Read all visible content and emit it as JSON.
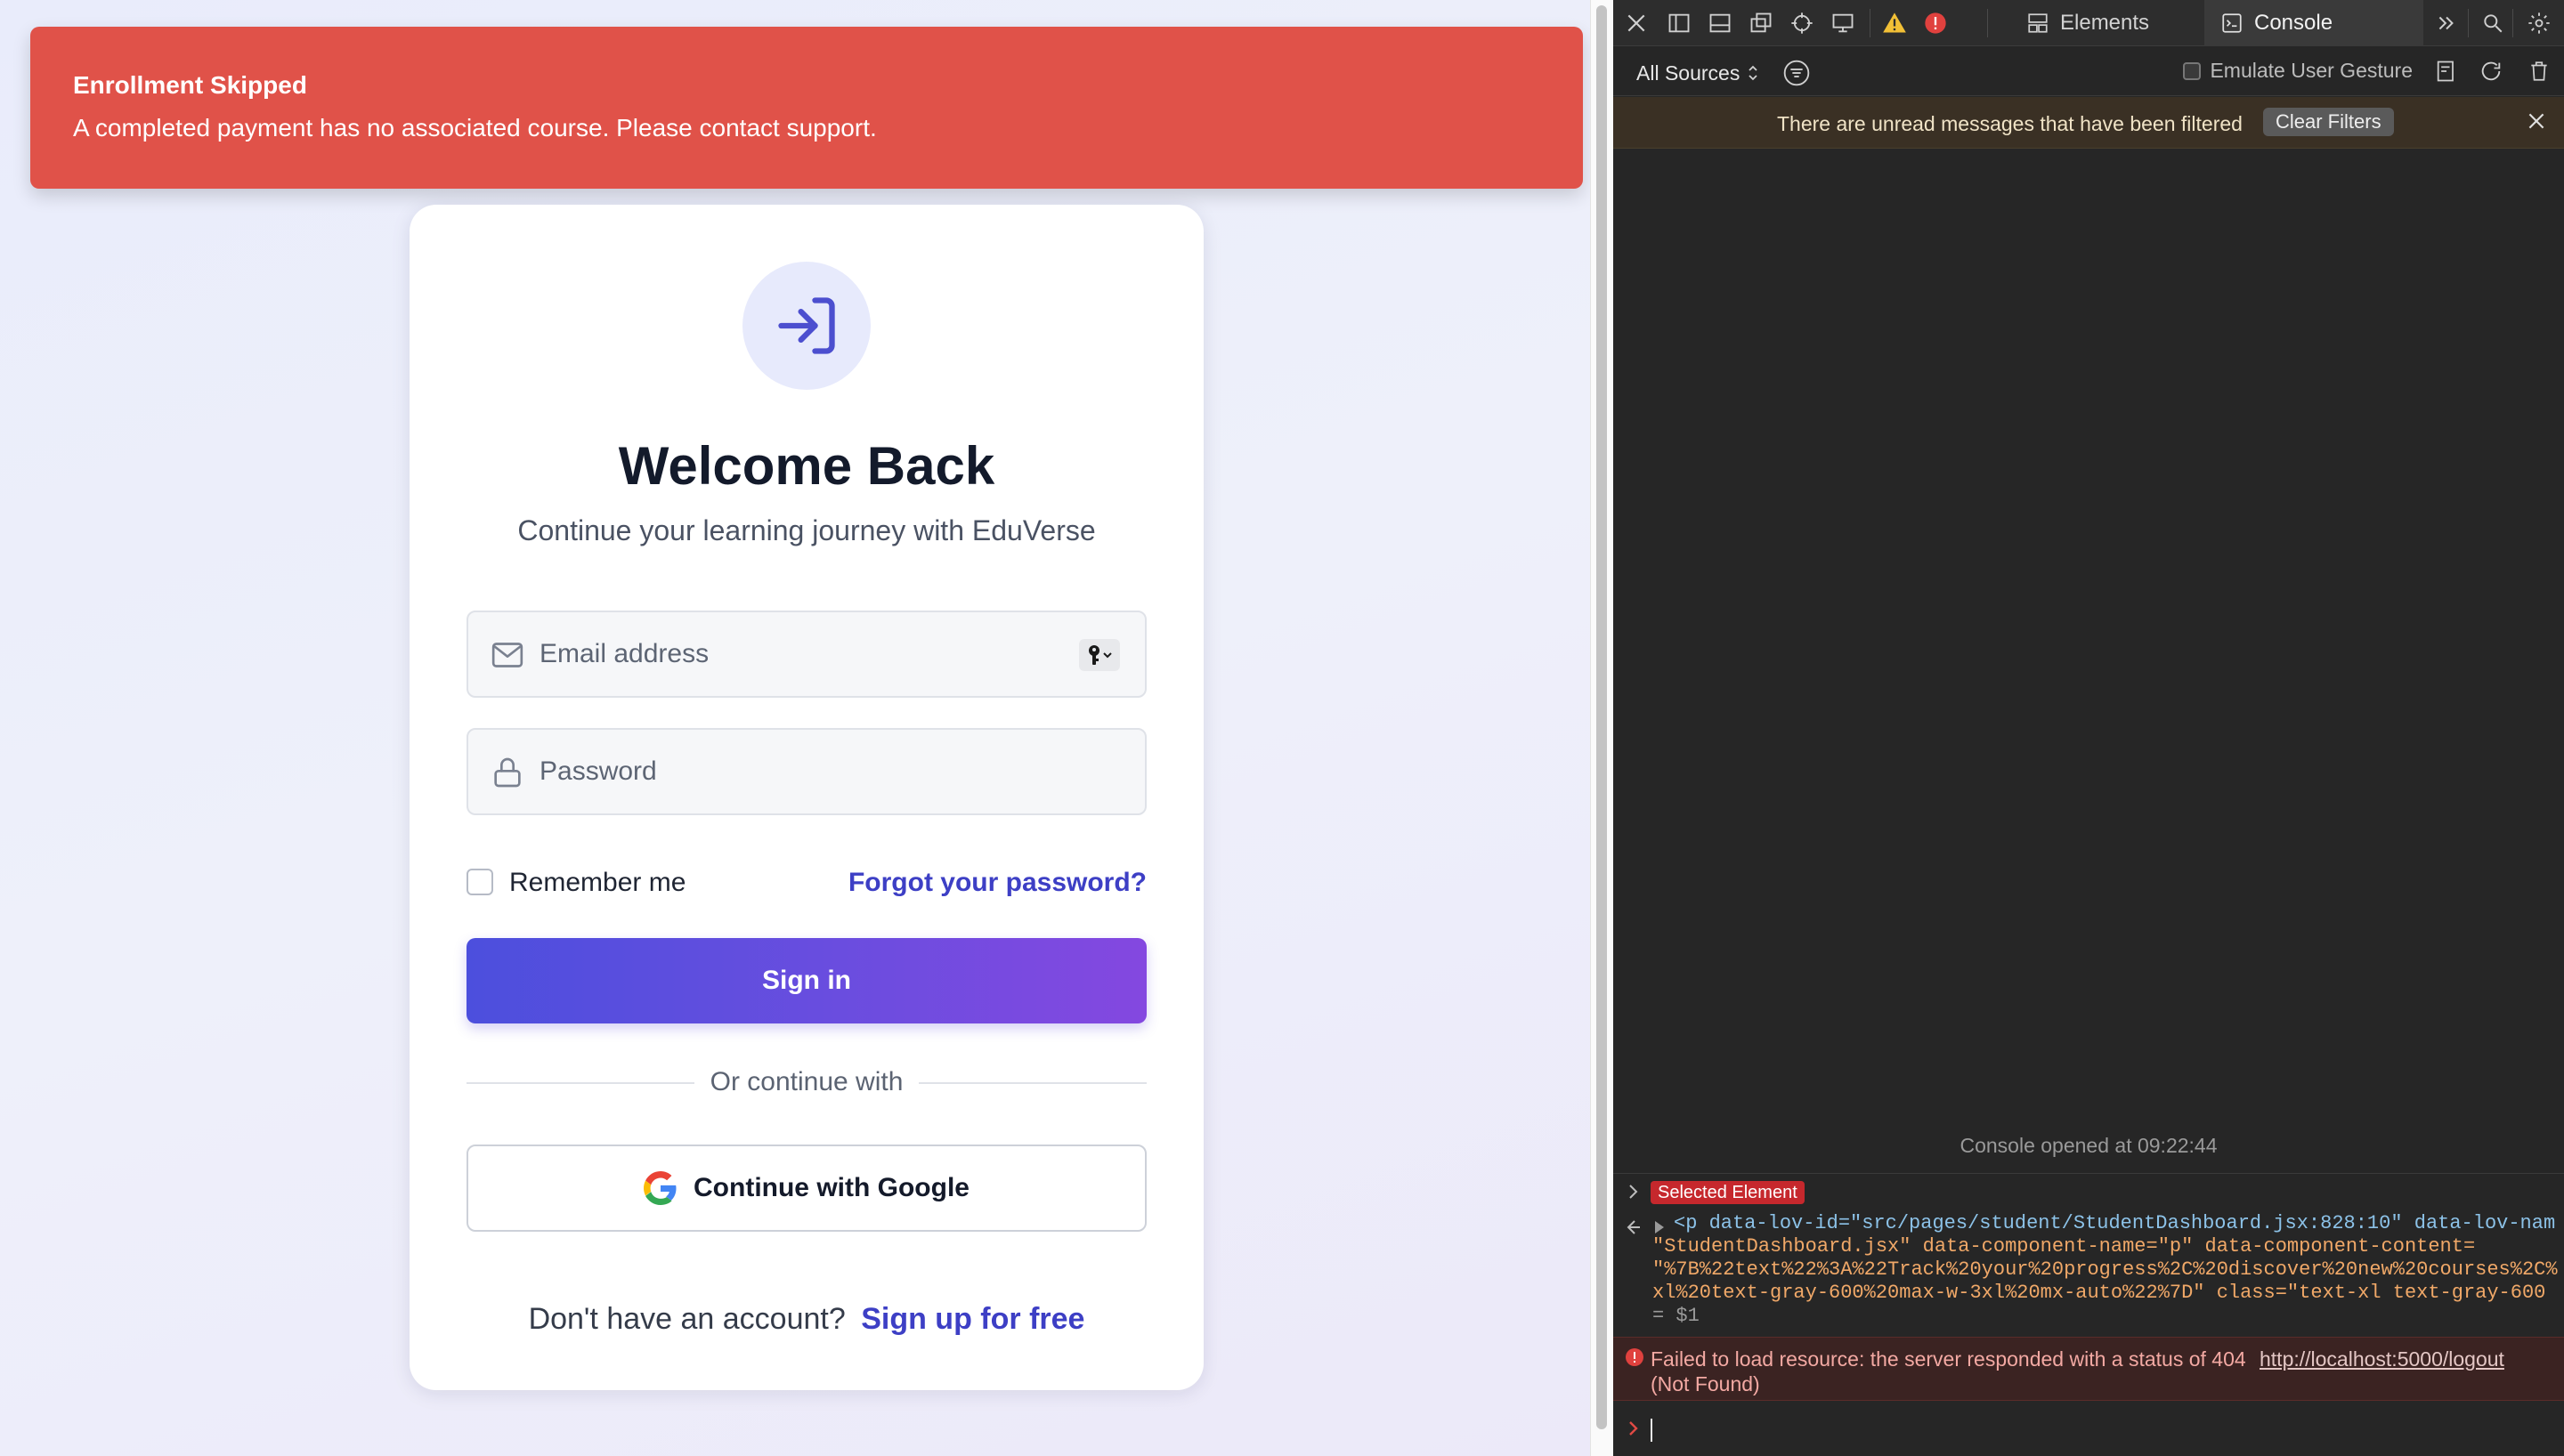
{
  "toast": {
    "title": "Enrollment Skipped",
    "message": "A completed payment has no associated course. Please contact support."
  },
  "login": {
    "title": "Welcome Back",
    "subtitle": "Continue your learning journey with EduVerse",
    "email_placeholder": "Email address",
    "password_placeholder": "Password",
    "remember_label": "Remember me",
    "forgot_label": "Forgot your password?",
    "signin_label": "Sign in",
    "divider_text": "Or continue with",
    "google_label": "Continue with Google",
    "signup_prompt": "Don't have an account?",
    "signup_link": "Sign up for free"
  },
  "colors": {
    "toast_bg": "#e05249",
    "brand_link": "#3d3fc5",
    "signin_start": "#4c4fdd",
    "signin_end": "#8448e0"
  },
  "devtools": {
    "tabs": {
      "elements": "Elements",
      "console": "Console"
    },
    "sources_filter": "All Sources",
    "emulate_label": "Emulate User Gesture",
    "banner_text": "There are unread messages that have been filtered",
    "clear_filters": "Clear Filters",
    "console_opened": "Console opened at 09:22:44",
    "selected_element_badge": "Selected Element",
    "code_lines": [
      "<p data-lov-id=\"src/pages/student/StudentDashboard.jsx:828:10\" data-lov-nam",
      "\"StudentDashboard.jsx\" data-component-name=\"p\" data-component-content=",
      "\"%7B%22text%22%3A%22Track%20your%20progress%2C%20discover%20new%20courses%2C%",
      "xl%20text-gray-600%20max-w-3xl%20mx-auto%22%7D\" class=\"text-xl text-gray-600",
      "= $1"
    ],
    "error_text": "Failed to load resource: the server responded with a status of 404 (Not Found)",
    "error_link": "http://localhost:5000/logout"
  }
}
